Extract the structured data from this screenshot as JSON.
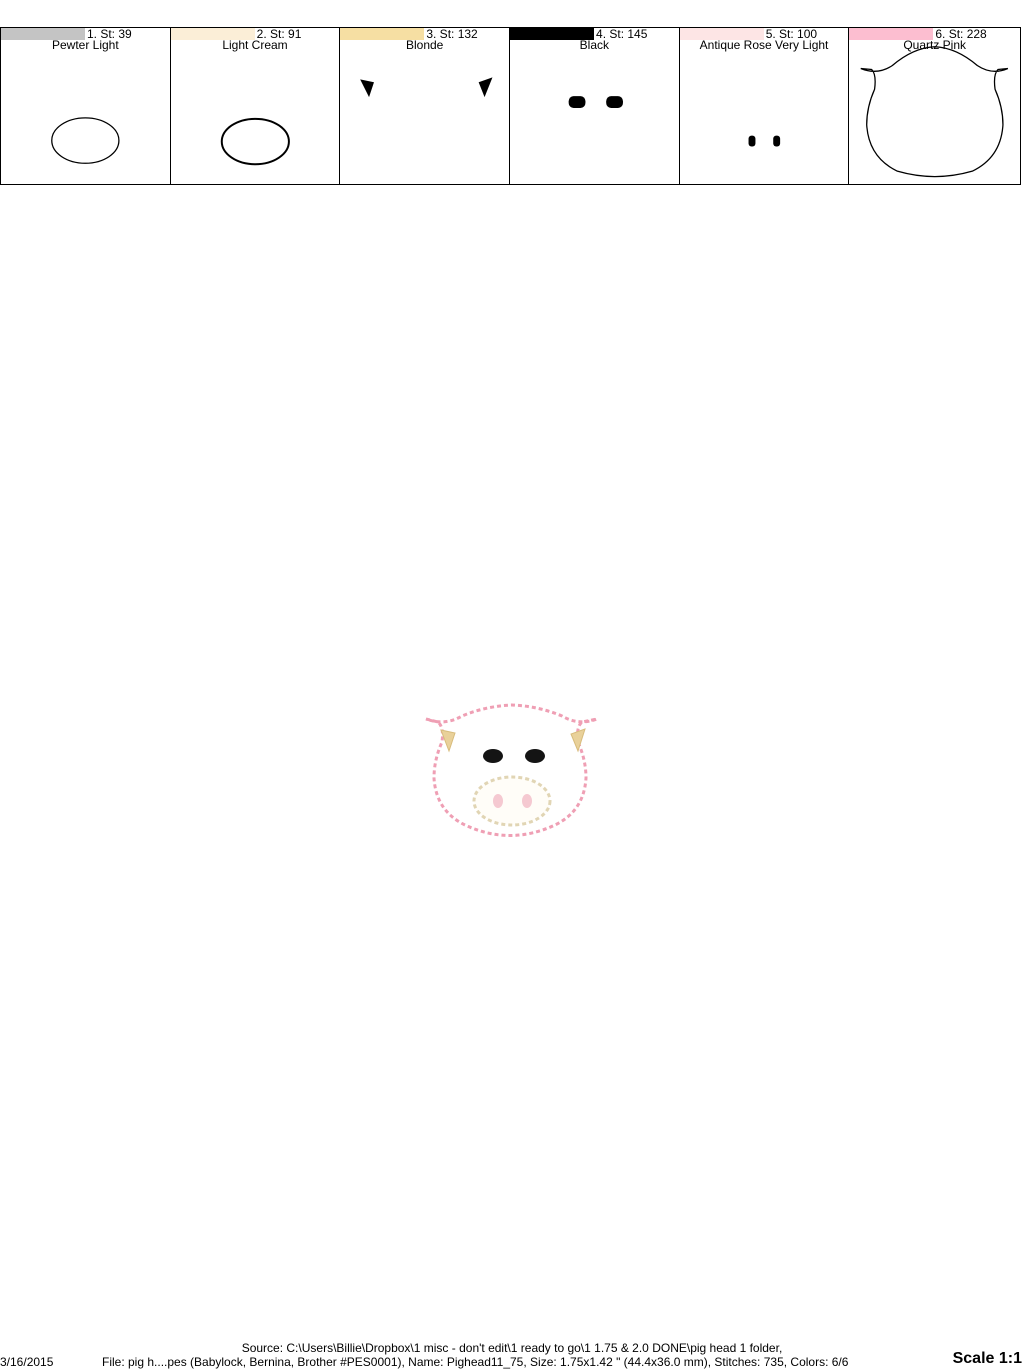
{
  "colors": [
    {
      "label": "1. St: 39",
      "name": "Pewter Light",
      "hex": "#c4c4c4"
    },
    {
      "label": "2. St: 91",
      "name": "Light Cream",
      "hex": "#fbeed7"
    },
    {
      "label": "3. St: 132",
      "name": "Blonde",
      "hex": "#f6dfa3"
    },
    {
      "label": "4. St: 145",
      "name": "Black",
      "hex": "#000000"
    },
    {
      "label": "5. St: 100",
      "name": "Antique Rose Very Light",
      "hex": "#fde5e5"
    },
    {
      "label": "6. St: 228",
      "name": "Quartz Pink",
      "hex": "#fcbed0"
    }
  ],
  "footer": {
    "source": "Source: C:\\Users\\Billie\\Dropbox\\1 misc - don't edit\\1 ready to go\\1 1.75 & 2.0 DONE\\pig head 1 folder,",
    "file": "File: pig h....pes (Babylock, Bernina, Brother #PES0001), Name: Pighead11_75, Size: 1.75x1.42 \" (44.4x36.0 mm), Stitches: 735, Colors: 6/6",
    "date": "3/16/2015",
    "scale": "Scale 1:1"
  }
}
